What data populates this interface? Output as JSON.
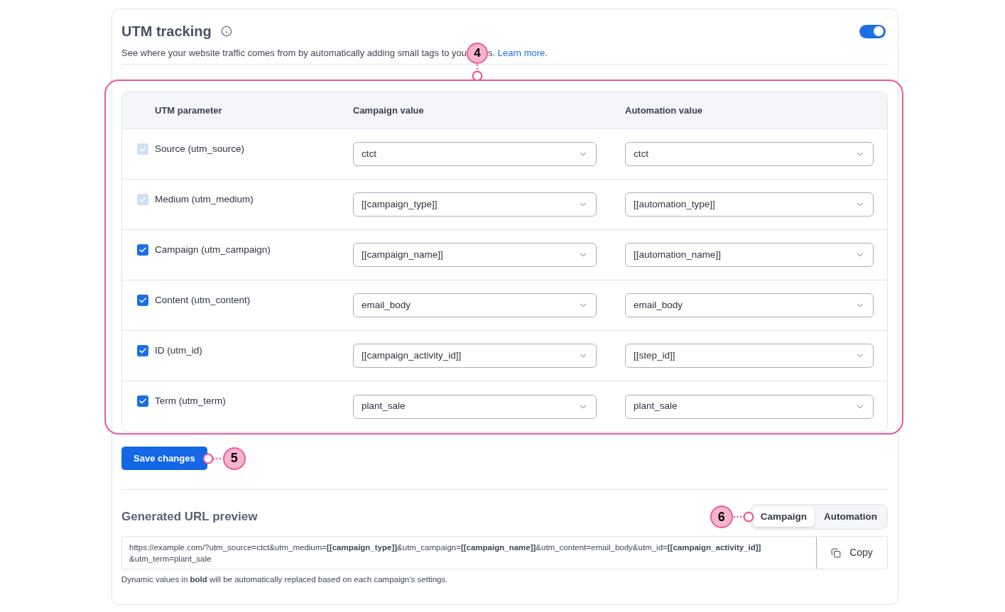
{
  "section": {
    "title": "UTM tracking",
    "description_before": "See where your website traffic comes from by automatically adding small tags to you",
    "description_after": "s.",
    "learn_more_link": "Learn more.",
    "toggle": {
      "on": true
    }
  },
  "utm_table": {
    "callout": "4",
    "columns": [
      "UTM parameter",
      "Campaign value",
      "Automation value"
    ],
    "rows": [
      {
        "parameter": "Source (utm_source)",
        "checked": true,
        "disabled": true,
        "campaign_value": "ctct",
        "automation_value": "ctct"
      },
      {
        "parameter": "Medium (utm_medium)",
        "checked": true,
        "disabled": true,
        "campaign_value": "[[campaign_type]]",
        "automation_value": "[[automation_type]]"
      },
      {
        "parameter": "Campaign (utm_campaign)",
        "checked": true,
        "disabled": false,
        "campaign_value": "[[campaign_name]]",
        "automation_value": "[[automation_name]]"
      },
      {
        "parameter": "Content (utm_content)",
        "checked": true,
        "disabled": false,
        "campaign_value": "email_body",
        "automation_value": "email_body"
      },
      {
        "parameter": "ID (utm_id)",
        "checked": true,
        "disabled": false,
        "campaign_value": "[[campaign_activity_id]]",
        "automation_value": "[[step_id]]"
      },
      {
        "parameter": "Term (utm_term)",
        "checked": true,
        "disabled": false,
        "campaign_value": "plant_sale",
        "automation_value": "plant_sale"
      }
    ]
  },
  "save_button": {
    "label": "Save changes",
    "callout": "5"
  },
  "url_preview": {
    "title": "Generated URL preview",
    "callout": "6",
    "tabs": [
      {
        "label": "Campaign",
        "selected": true
      },
      {
        "label": "Automation",
        "selected": false
      }
    ],
    "url_lines": [
      "https://example.com/?utm_source=ctct&utm_medium=**[[campaign_type]]**&utm_campaign=**[[campaign_name]]**&utm_content=email_body&utm_id=**[[campaign_activity_id]]**",
      "&utm_term=plant_sale"
    ],
    "copy_button": "Copy",
    "note": "Dynamic values in **bold** will be automatically replaced based on each campaign’s settings."
  }
}
